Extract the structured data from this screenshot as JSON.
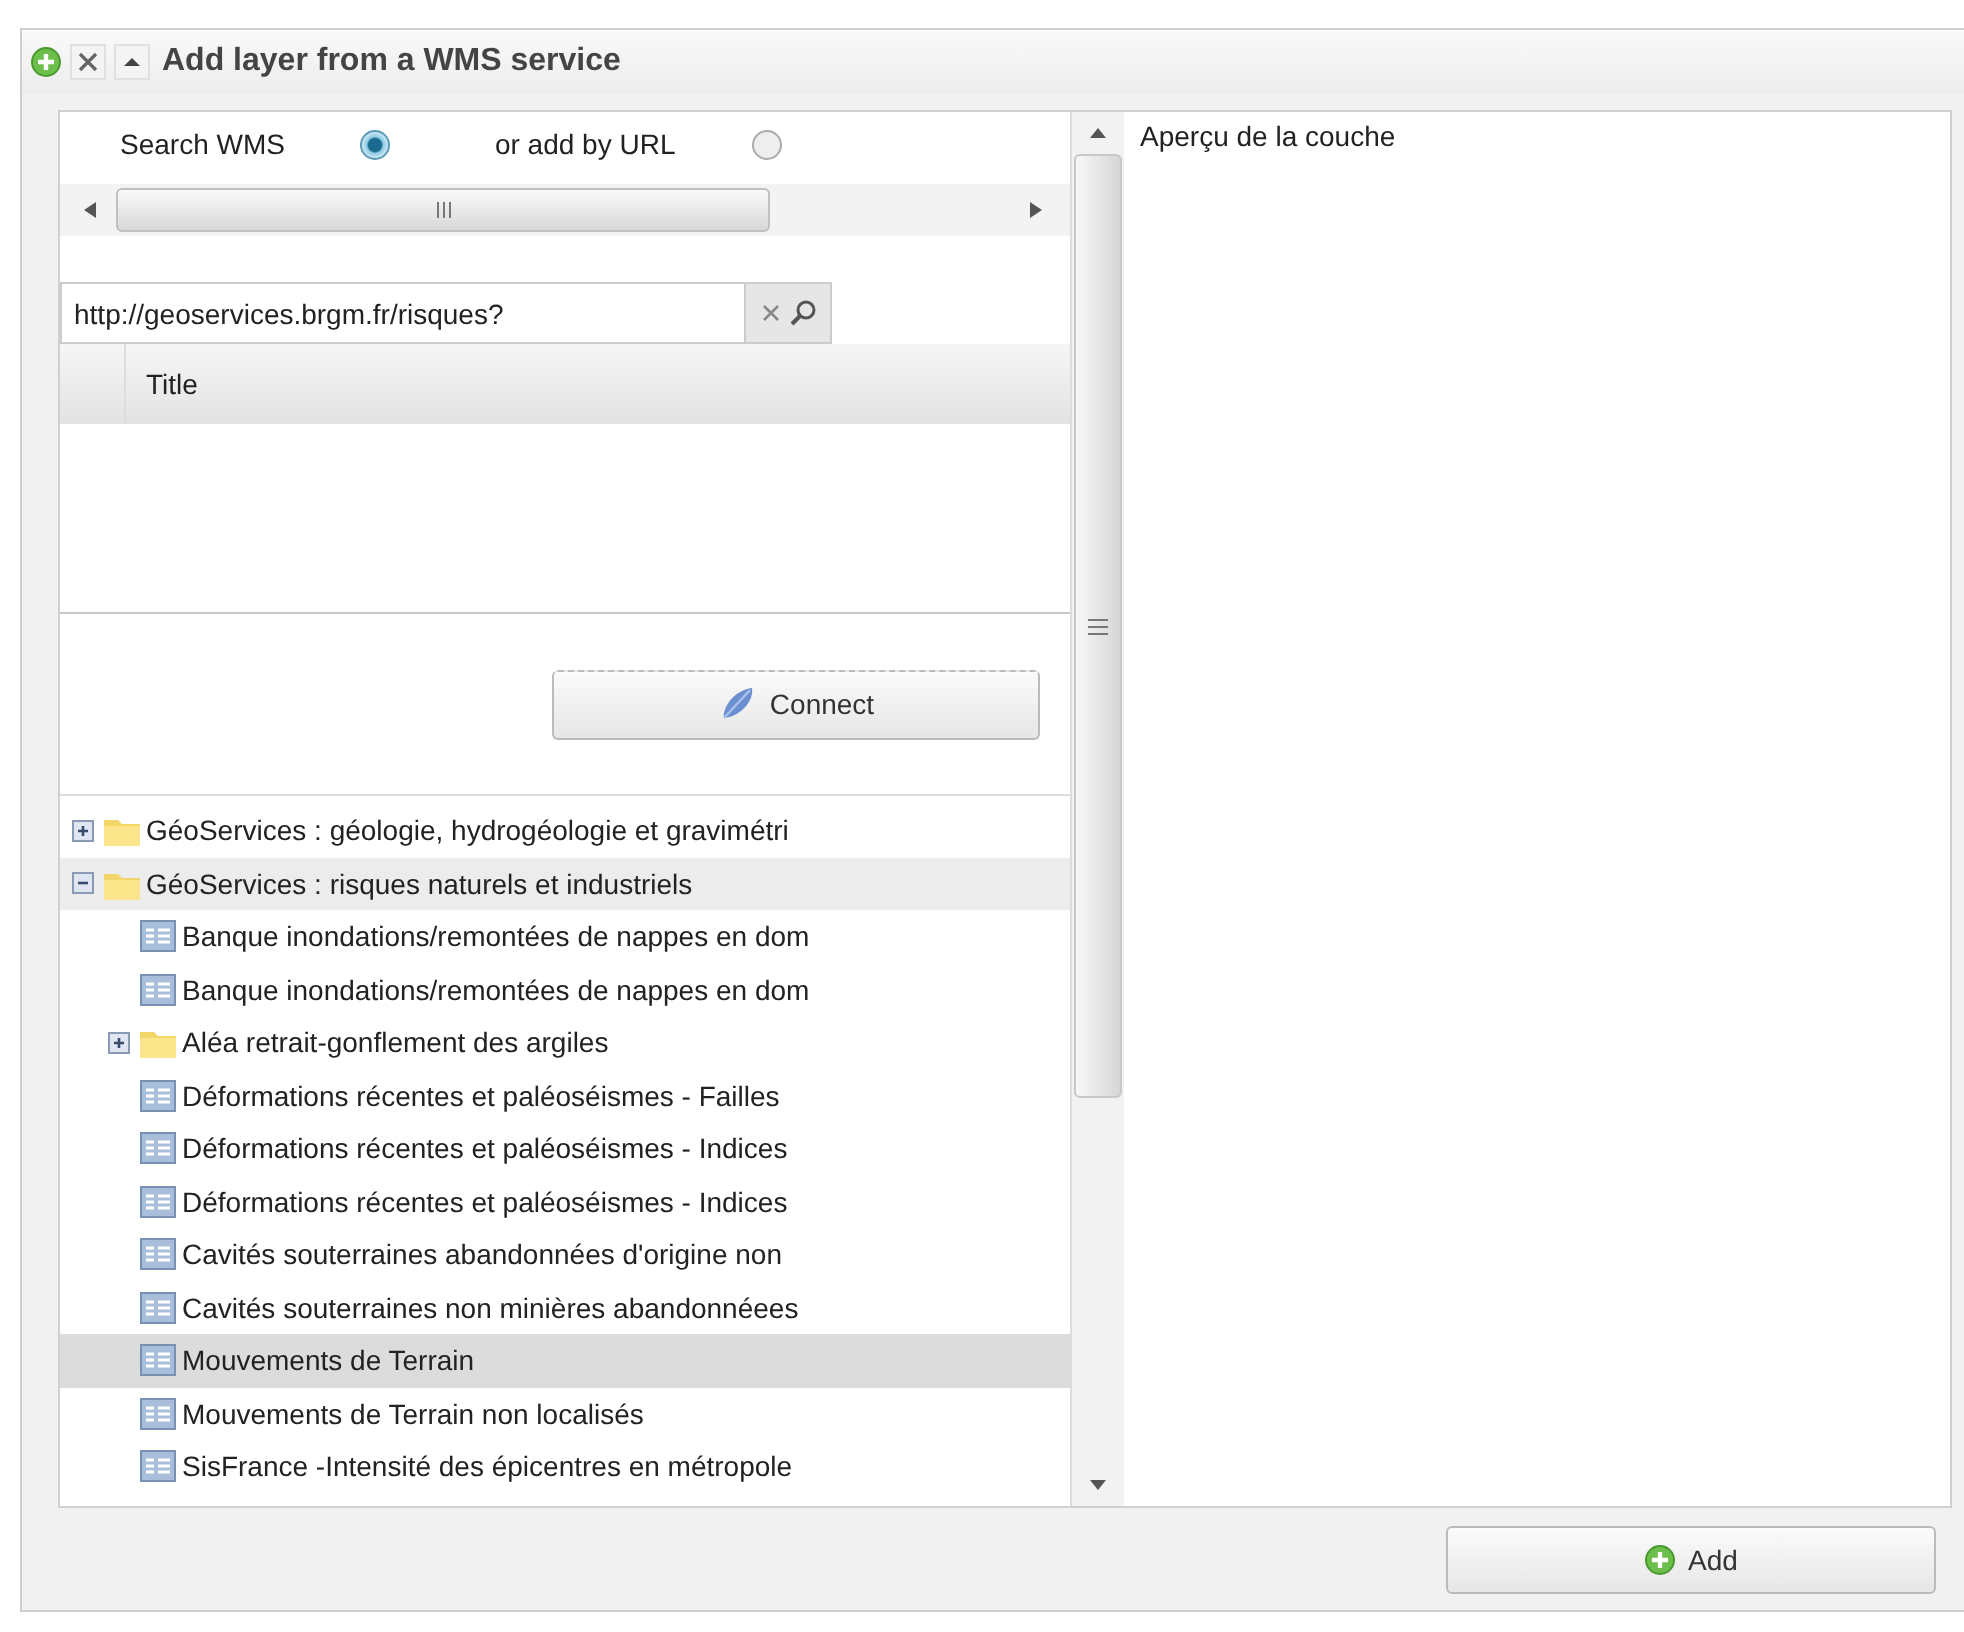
{
  "window": {
    "title": "Add layer from a WMS service"
  },
  "source_options": [
    {
      "label": "Search WMS",
      "selected": true
    },
    {
      "label": "or add by URL",
      "selected": false
    }
  ],
  "url_field": {
    "value": "http://geoservices.brgm.fr/risques?"
  },
  "results_table": {
    "columns": [
      "Title"
    ]
  },
  "connect_button": "Connect",
  "tree": [
    {
      "label": "GéoServices : géologie, hydrogéologie et gravimétri",
      "kind": "folder",
      "expanded": false,
      "selected": false,
      "hovered": false
    },
    {
      "label": "GéoServices : risques naturels et industriels",
      "kind": "folder",
      "expanded": true,
      "selected": false,
      "hovered": true,
      "children": [
        {
          "label": "Banque inondations/remontées de nappes en dom",
          "kind": "layer",
          "selected": false,
          "hovered": false
        },
        {
          "label": "Banque inondations/remontées de nappes en dom",
          "kind": "layer",
          "selected": false,
          "hovered": false
        },
        {
          "label": "Aléa retrait-gonflement des argiles",
          "kind": "folder",
          "expanded": false,
          "selected": false,
          "hovered": false
        },
        {
          "label": "Déformations récentes et paléoséismes - Failles",
          "kind": "layer",
          "selected": false,
          "hovered": false
        },
        {
          "label": "Déformations récentes et paléoséismes - Indices",
          "kind": "layer",
          "selected": false,
          "hovered": false
        },
        {
          "label": "Déformations récentes et paléoséismes - Indices",
          "kind": "layer",
          "selected": false,
          "hovered": false
        },
        {
          "label": "Cavités souterraines abandonnées d'origine non",
          "kind": "layer",
          "selected": false,
          "hovered": false
        },
        {
          "label": "Cavités souterraines non minières abandonnéees",
          "kind": "layer",
          "selected": false,
          "hovered": false
        },
        {
          "label": "Mouvements de Terrain",
          "kind": "layer",
          "selected": true,
          "hovered": false
        },
        {
          "label": "Mouvements de Terrain non localisés",
          "kind": "layer",
          "selected": false,
          "hovered": false
        },
        {
          "label": "SisFrance -Intensité des épicentres en métropole",
          "kind": "layer",
          "selected": false,
          "hovered": false
        }
      ]
    }
  ],
  "preview": {
    "title": "Aperçu de la couche"
  },
  "add_button": "Add"
}
